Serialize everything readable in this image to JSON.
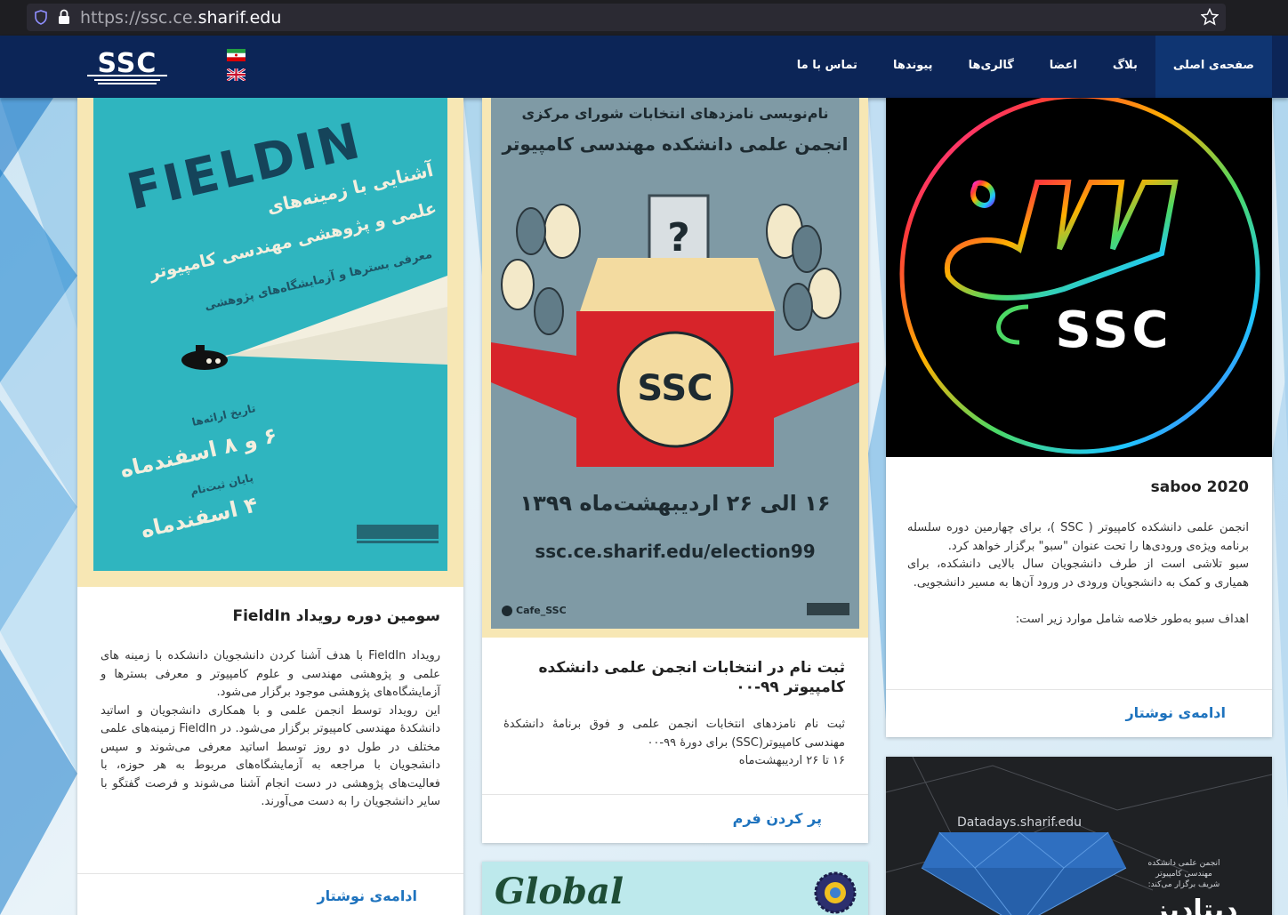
{
  "browser": {
    "url_prefix": "https://ssc.ce.",
    "url_domain": "sharif.edu",
    "url_suffix": ""
  },
  "nav": {
    "logo_text": "SSC",
    "menu": [
      {
        "label": "صفحه‌ی اصلی",
        "active": true
      },
      {
        "label": "بلاگ"
      },
      {
        "label": "اعضا"
      },
      {
        "label": "گالری‌ها"
      },
      {
        "label": "پیوندها"
      },
      {
        "label": "تماس با ما"
      }
    ]
  },
  "cards": {
    "fieldin": {
      "poster_title": "FIELDIN",
      "poster_line1": "آشنایی با زمینه‌های",
      "poster_line2": "علمی و پژوهشی مهندسی کامپیوتر",
      "poster_line3": "معرفی بسترها و آزمایشگاه‌های پژوهشی",
      "poster_date_label": "تاریخ ارائه‌ها",
      "poster_date": "۶ و ۸ اسفندماه",
      "poster_end_label": "پایان ثبت‌نام",
      "poster_end": "۴ اسفندماه",
      "title": "سومین دوره رویداد FieldIn",
      "body": "رویداد FieldIn با هدف آشنا کردن دانشجویان دانشکده با زمینه های علمی و پژوهشی مهندسی و علوم کامپیوتر و معرفی بسترها و آزمایشگاه‌های پژوهشی موجود برگزار می‌شود.\nاین رویداد توسط انجمن علمی و با همکاری دانشجویان و اساتید دانشکدهٔ مهندسی کامپیوتر برگزار می‌شود. در FieldIn زمینه‌های علمی مختلف در طول دو روز توسط اساتید معرفی می‌شوند و سپس دانشجویان با مراجعه به آزمایشگاه‌های مربوط به هر حوزه، با فعالیت‌های پژوهشی در دست انجام آشنا می‌شوند و فرصت گفتگو با سایر دانشجویان را به دست می‌آورند.",
      "more": "ادامه‌ی نوشتار"
    },
    "election": {
      "poster_line1": "نام‌نویسی نامزدهای انتخابات شورای مرکزی",
      "poster_line2": "انجمن علمی دانشکده مهندسی کامپیوتر",
      "poster_date": "۱۶ الی ۲۶ اردیبهشت‌ماه ۱۳۹۹",
      "poster_url": "ssc.ce.sharif.edu/election99",
      "poster_handle": "Cafe_SSC",
      "title": "ثبت نام در انتخابات انجمن علمی دانشکده کامپیوتر ۹۹-۰۰",
      "body": "ثبت نام نامزدهای انتخابات انجمن علمی و فوق برنامهٔ دانشکدهٔ مهندسی کامپیوتر(SSC) برای دورهٔ ۹۹-۰۰\n۱۶ تا ۲۶ اردیبهشت‌ماه",
      "more": "پر کردن فرم"
    },
    "saboo": {
      "title": "saboo 2020",
      "body": "انجمن علمی دانشکده کامپیوتر ( SSC )، برای چهارمین دوره سلسله برنامه ویژه‌ی ورودی‌ها را تحت عنوان \"سبو\" برگزار خواهد کرد.\nسبو تلاشی است از طرف دانشجویان سال بالایی دانشکده، برای همیاری و کمک به دانشجویان ورودی در ورود آن‌ها به مسیر دانشجویی.\n\nاهداف سبو به‌طور خلاصه شامل موارد زیر است:",
      "more": "ادامه‌ی نوشتار"
    },
    "datadays": {
      "site": "Datadays.sharif.edu",
      "org": "انجمن علمی دانشکده مهندسی کامپیوتر شریف برگزار می‌کند:",
      "big": "دیتادیز"
    },
    "global": {
      "title": "Global"
    }
  }
}
